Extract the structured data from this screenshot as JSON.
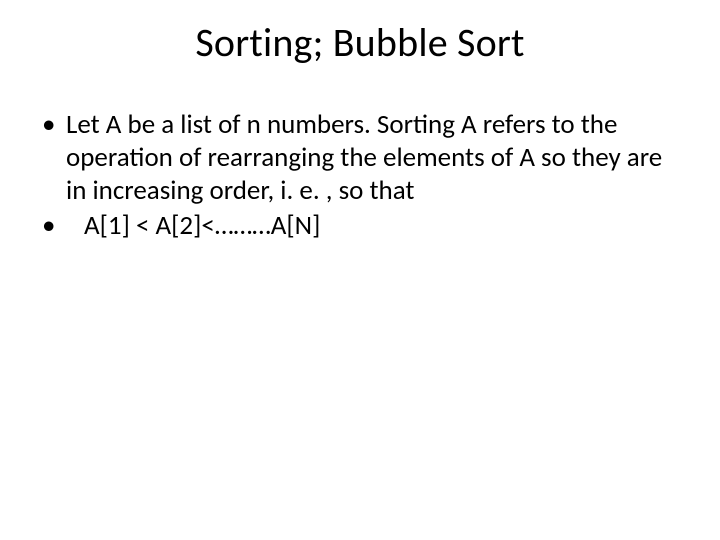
{
  "slide": {
    "title": "Sorting; Bubble Sort",
    "bullets": [
      "Let A be a list of n numbers. Sorting A refers to the operation of rearranging the elements of A so they are in increasing order, i. e. , so that",
      "A[1] < A[2]<………A[N]"
    ]
  }
}
